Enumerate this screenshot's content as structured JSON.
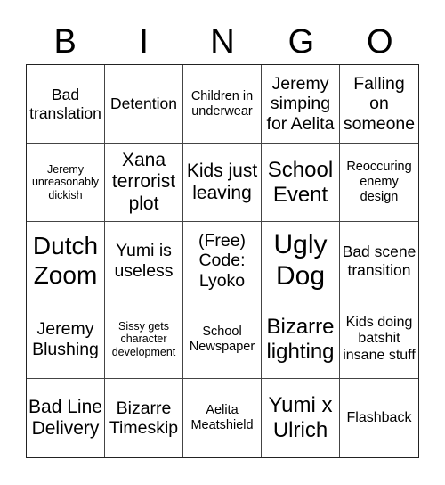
{
  "title_letters": [
    "B",
    "I",
    "N",
    "G",
    "O"
  ],
  "cells": [
    "Bad translation",
    "Detention",
    "Children in underwear",
    "Jeremy simping for Aelita",
    "Falling on someone",
    "Jeremy unreasonably dickish",
    "Xana terrorist plot",
    "Kids just leaving",
    "School Event",
    "Reoccuring enemy design",
    "Dutch Zoom",
    "Yumi is useless",
    "(Free) Code: Lyoko",
    "Ugly Dog",
    "Bad scene transition",
    "Jeremy Blushing",
    "Sissy gets character development",
    "School Newspaper",
    "Bizarre lighting",
    "Kids doing batshit insane stuff",
    "Bad Line Delivery",
    "Bizarre Timeskip",
    "Aelita Meatshield",
    "Yumi x Ulrich",
    "Flashback"
  ],
  "free_cell_index": 12
}
